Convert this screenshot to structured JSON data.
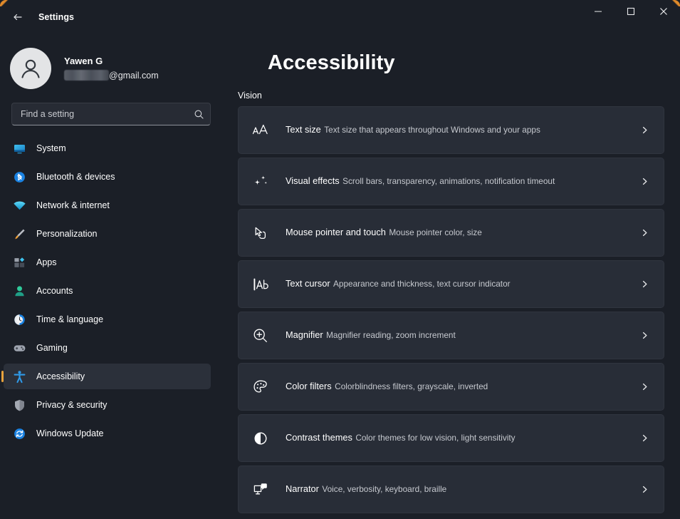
{
  "window": {
    "title": "Settings",
    "back_icon": "arrow-left-icon",
    "controls": {
      "minimize": "minimize-icon",
      "maximize": "maximize-icon",
      "close": "close-icon"
    },
    "accent_color": "#e8a33d",
    "background_color": "#1b1f27",
    "card_color": "#282d37"
  },
  "account": {
    "name": "Yawen G",
    "email_visible_suffix": "@gmail.com",
    "email_redacted": true,
    "avatar_icon": "person-avatar-icon"
  },
  "search": {
    "placeholder": "Find a setting",
    "value": "",
    "icon": "search-icon"
  },
  "sidebar": {
    "items": [
      {
        "label": "System",
        "icon": "monitor-icon",
        "selected": false
      },
      {
        "label": "Bluetooth & devices",
        "icon": "bluetooth-icon",
        "selected": false
      },
      {
        "label": "Network & internet",
        "icon": "wifi-icon",
        "selected": false
      },
      {
        "label": "Personalization",
        "icon": "paintbrush-icon",
        "selected": false
      },
      {
        "label": "Apps",
        "icon": "apps-grid-icon",
        "selected": false
      },
      {
        "label": "Accounts",
        "icon": "person-icon",
        "selected": false
      },
      {
        "label": "Time & language",
        "icon": "clock-icon",
        "selected": false
      },
      {
        "label": "Gaming",
        "icon": "gamepad-icon",
        "selected": false
      },
      {
        "label": "Accessibility",
        "icon": "accessibility-icon",
        "selected": true
      },
      {
        "label": "Privacy & security",
        "icon": "shield-icon",
        "selected": false
      },
      {
        "label": "Windows Update",
        "icon": "update-refresh-icon",
        "selected": false
      }
    ]
  },
  "main": {
    "page_title": "Accessibility",
    "section_label": "Vision",
    "cards": [
      {
        "title": "Text size",
        "subtitle": "Text size that appears throughout Windows and your apps",
        "icon": "text-size-aa-icon",
        "chevron": "chevron-right-icon"
      },
      {
        "title": "Visual effects",
        "subtitle": "Scroll bars, transparency, animations, notification timeout",
        "icon": "sparkles-icon",
        "chevron": "chevron-right-icon"
      },
      {
        "title": "Mouse pointer and touch",
        "subtitle": "Mouse pointer color, size",
        "icon": "mouse-pointer-touch-icon",
        "chevron": "chevron-right-icon"
      },
      {
        "title": "Text cursor",
        "subtitle": "Appearance and thickness, text cursor indicator",
        "icon": "text-cursor-ab-icon",
        "chevron": "chevron-right-icon"
      },
      {
        "title": "Magnifier",
        "subtitle": "Magnifier reading, zoom increment",
        "icon": "magnifier-plus-icon",
        "chevron": "chevron-right-icon"
      },
      {
        "title": "Color filters",
        "subtitle": "Colorblindness filters, grayscale, inverted",
        "icon": "color-palette-icon",
        "chevron": "chevron-right-icon"
      },
      {
        "title": "Contrast themes",
        "subtitle": "Color themes for low vision, light sensitivity",
        "icon": "contrast-half-circle-icon",
        "chevron": "chevron-right-icon"
      },
      {
        "title": "Narrator",
        "subtitle": "Voice, verbosity, keyboard, braille",
        "icon": "narrator-monitor-speech-icon",
        "chevron": "chevron-right-icon"
      }
    ]
  }
}
